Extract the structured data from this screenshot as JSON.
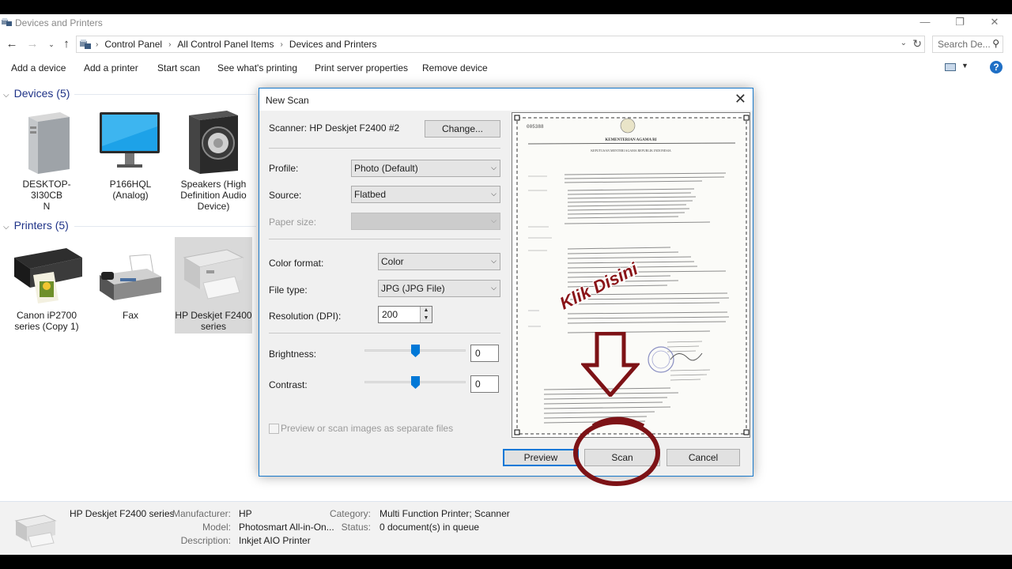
{
  "window": {
    "title": "Devices and Printers",
    "controls": [
      "—",
      "❐",
      "✕"
    ]
  },
  "address": {
    "breadcrumbs": [
      "Control Panel",
      "All Control Panel Items",
      "Devices and Printers"
    ],
    "search_placeholder": "Search De..."
  },
  "toolbar": {
    "items": [
      "Add a device",
      "Add a printer",
      "Start scan",
      "See what's printing",
      "Print server properties",
      "Remove device"
    ]
  },
  "devices": {
    "header": "Devices (5)",
    "items": [
      {
        "label": "DESKTOP-3I30CBN",
        "line1": "DESKTOP-3I30CB",
        "line2": "N",
        "icon": "tower-pc-icon"
      },
      {
        "label": "P166HQL (Analog)",
        "line1": "P166HQL",
        "line2": "(Analog)",
        "icon": "monitor-icon"
      },
      {
        "label": "Speakers (High Definition Audio Device)",
        "line1": "Speakers (High",
        "line2": "Definition Audio",
        "line3": "Device)",
        "icon": "speaker-icon"
      }
    ]
  },
  "printers": {
    "header": "Printers (5)",
    "items": [
      {
        "line1": "Canon iP2700",
        "line2": "series (Copy 1)",
        "icon": "printer-icon"
      },
      {
        "line1": "Fax",
        "icon": "fax-icon"
      },
      {
        "line1": "HP Deskjet F2400",
        "line2": "series",
        "icon": "all-in-one-printer-icon",
        "selected": true
      }
    ]
  },
  "details": {
    "name": "HP Deskjet F2400 series",
    "manufacturer_label": "Manufacturer:",
    "manufacturer": "HP",
    "model_label": "Model:",
    "model": "Photosmart All-in-On...",
    "description_label": "Description:",
    "description": "Inkjet AIO Printer",
    "category_label": "Category:",
    "category": "Multi Function Printer; Scanner",
    "status_label": "Status:",
    "status": "0 document(s) in queue"
  },
  "dialog": {
    "title": "New Scan",
    "scanner_label": "Scanner: HP Deskjet F2400 #2",
    "change_button": "Change...",
    "profile_label": "Profile:",
    "profile_value": "Photo (Default)",
    "source_label": "Source:",
    "source_value": "Flatbed",
    "paper_size_label": "Paper size:",
    "color_format_label": "Color format:",
    "color_format_value": "Color",
    "file_type_label": "File type:",
    "file_type_value": "JPG (JPG File)",
    "resolution_label": "Resolution (DPI):",
    "resolution_value": "200",
    "brightness_label": "Brightness:",
    "brightness_value": "0",
    "contrast_label": "Contrast:",
    "contrast_value": "0",
    "separate_files_label": "Preview or scan images as separate files",
    "preview_button": "Preview",
    "scan_button": "Scan",
    "cancel_button": "Cancel"
  },
  "preview_doc": {
    "number": "005388",
    "ministry": "KEMENTERIAN AGAMA RI",
    "heading": "KEPUTUSAN MENTERI AGAMA REPUBLIK INDONESIA"
  },
  "annotation": {
    "text": "Klik Disini",
    "color": "#8a1418"
  }
}
